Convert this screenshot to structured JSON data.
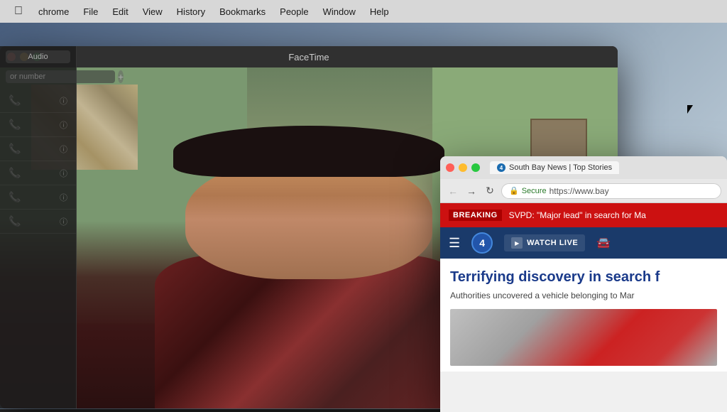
{
  "menubar": {
    "items": [
      "chrome",
      "File",
      "Edit",
      "View",
      "History",
      "Bookmarks",
      "People",
      "Window",
      "Help"
    ]
  },
  "facetime": {
    "title": "FaceTime",
    "audio_tab": "Audio",
    "input_placeholder": "or number",
    "contacts": [
      {
        "id": 1
      },
      {
        "id": 2
      },
      {
        "id": 3
      },
      {
        "id": 4
      },
      {
        "id": 5
      },
      {
        "id": 6
      }
    ]
  },
  "browser": {
    "tab_title": "South Bay News | Top Stories",
    "channel_number": "4",
    "secure_label": "Secure",
    "url": "https://www.bay",
    "breaking_label": "BREAKING",
    "breaking_news": "SVPD: \"Major lead\" in search for Ma",
    "watch_live": "WATCH LIVE",
    "headline": "Terrifying discovery in search f",
    "subtext": "Authorities uncovered a vehicle belonging to Mar"
  }
}
